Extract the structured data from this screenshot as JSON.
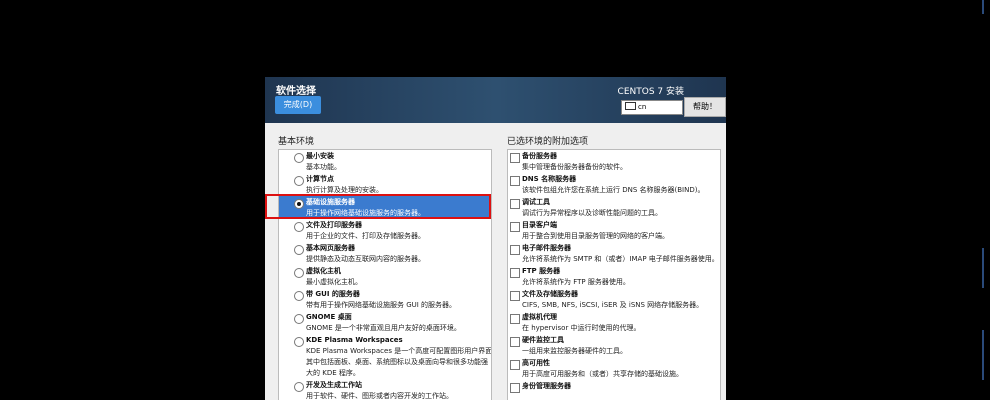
{
  "header": {
    "title": "软件选择",
    "done_label": "完成(D)",
    "product": "CENTOS 7 安装",
    "keyboard": "cn",
    "help_label": "帮助！"
  },
  "base_env": {
    "heading": "基本环境",
    "selected_index": 2,
    "items": [
      {
        "title": "最小安装",
        "desc": "基本功能。"
      },
      {
        "title": "计算节点",
        "desc": "执行计算及处理的安装。"
      },
      {
        "title": "基础设施服务器",
        "desc": "用于操作网络基础设施服务的服务器。"
      },
      {
        "title": "文件及打印服务器",
        "desc": "用于企业的文件、打印及存储服务器。"
      },
      {
        "title": "基本网页服务器",
        "desc": "提供静态及动态互联网内容的服务器。"
      },
      {
        "title": "虚拟化主机",
        "desc": "最小虚拟化主机。"
      },
      {
        "title": "带 GUI 的服务器",
        "desc": "带有用于操作网络基础设施服务 GUI 的服务器。"
      },
      {
        "title": "GNOME 桌面",
        "desc": "GNOME 是一个非常直观且用户友好的桌面环境。"
      },
      {
        "title": "KDE Plasma Workspaces",
        "desc": "KDE Plasma Workspaces 是一个高度可配置图形用户界面，",
        "desc2": "其中包括面板、桌面、系统图标以及桌面向导和很多功能强",
        "desc3": "大的 KDE 程序。"
      },
      {
        "title": "开发及生成工作站",
        "desc": "用于软件、硬件、图形或者内容开发的工作站。"
      }
    ]
  },
  "addons": {
    "heading": "已选环境的附加选项",
    "items": [
      {
        "title": "备份服务器",
        "desc": "集中管理备份服务器备份的软件。"
      },
      {
        "title": "DNS 名称服务器",
        "desc": "该软件包组允许您在系统上运行 DNS 名称服务器(BIND)。"
      },
      {
        "title": "调试工具",
        "desc": "调试行为异常程序以及诊断性能问题的工具。"
      },
      {
        "title": "目录客户端",
        "desc": "用于整合到使用目录服务管理的网络的客户端。"
      },
      {
        "title": "电子邮件服务器",
        "desc": "允许将系统作为 SMTP 和（或者）IMAP 电子邮件服务器使用。"
      },
      {
        "title": "FTP 服务器",
        "desc": "允许将系统作为 FTP 服务器使用。"
      },
      {
        "title": "文件及存储服务器",
        "desc": "CIFS, SMB, NFS, iSCSI, iSER 及 iSNS 网络存储服务器。"
      },
      {
        "title": "虚拟机代理",
        "desc": "在 hypervisor 中运行时使用的代理。"
      },
      {
        "title": "硬件监控工具",
        "desc": "一组用来监控服务器硬件的工具。"
      },
      {
        "title": "高可用性",
        "desc": "用于高度可用服务和（或者）共享存储的基础设施。"
      },
      {
        "title": "身份管理服务器",
        "desc": ""
      }
    ]
  }
}
